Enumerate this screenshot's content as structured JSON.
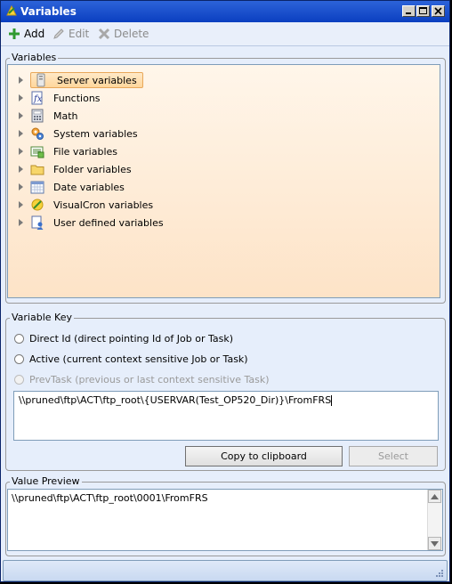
{
  "window": {
    "title": "Variables"
  },
  "toolbar": {
    "add_label": "Add",
    "edit_label": "Edit",
    "delete_label": "Delete"
  },
  "variables": {
    "legend": "Variables",
    "items": [
      {
        "label": "Server variables",
        "icon": "server-icon",
        "selected": true
      },
      {
        "label": "Functions",
        "icon": "functions-icon"
      },
      {
        "label": "Math",
        "icon": "calculator-icon"
      },
      {
        "label": "System variables",
        "icon": "gears-icon"
      },
      {
        "label": "File variables",
        "icon": "file-icon"
      },
      {
        "label": "Folder variables",
        "icon": "folder-icon"
      },
      {
        "label": "Date variables",
        "icon": "calendar-icon"
      },
      {
        "label": "VisualCron variables",
        "icon": "visualcron-icon"
      },
      {
        "label": "User defined variables",
        "icon": "user-file-icon"
      }
    ]
  },
  "variable_key": {
    "legend": "Variable Key",
    "options": [
      {
        "label": "Direct Id (direct pointing Id of Job or Task)",
        "enabled": true
      },
      {
        "label": "Active (current context sensitive Job or Task)",
        "enabled": true
      },
      {
        "label": "PrevTask (previous or last context sensitive Task)",
        "enabled": false
      }
    ],
    "value": "\\\\pruned\\ftp\\ACT\\ftp_root\\{USERVAR(Test_OP520_Dir)}\\FromFRS",
    "copy_label": "Copy to clipboard",
    "select_label": "Select"
  },
  "value_preview": {
    "legend": "Value Preview",
    "value": "\\\\pruned\\ftp\\ACT\\ftp_root\\0001\\FromFRS"
  }
}
